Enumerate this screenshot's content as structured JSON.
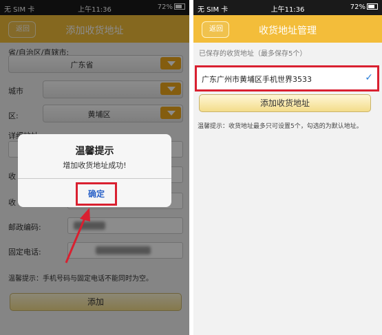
{
  "left_screen": {
    "status": {
      "carrier": "无 SIM 卡",
      "time": "上午11:36",
      "battery": "72%"
    },
    "nav": {
      "back_label": "返回",
      "title": "添加收货地址"
    },
    "form": {
      "province_label": "省/自治区/直辖市:",
      "province_value": "广东省",
      "city_label": "城市",
      "district_label": "区:",
      "district_value": "黄埔区",
      "address_label": "详细地址",
      "postal_label": "邮政编码:",
      "phone_label": "固定电话:",
      "mobile_label": "收",
      "receiver_label": "收",
      "tip": "温馨提示：手机号码与固定电话不能同时为空。",
      "add_button": "添加"
    },
    "alert": {
      "title": "温馨提示",
      "message": "增加收货地址成功!",
      "ok_button": "确定"
    }
  },
  "right_screen": {
    "status": {
      "carrier": "无 SIM 卡",
      "time": "上午11:36",
      "battery": "72%"
    },
    "nav": {
      "back_label": "返回",
      "title": "收货地址管理"
    },
    "saved_label": "已保存的收货地址（最多保存5个）",
    "addresses": [
      {
        "text": "广东广州市黄埔区手机世界3533",
        "checked": true
      }
    ],
    "add_button": "添加收货地址",
    "tip": "温馨提示：收货地址最多只可设置5个，勾选的为默认地址。"
  },
  "colors": {
    "nav": "#f3bd3a",
    "highlight": "#d92030",
    "arrow": "#d92030",
    "link": "#2a62c8",
    "check": "#2b7ed8"
  }
}
